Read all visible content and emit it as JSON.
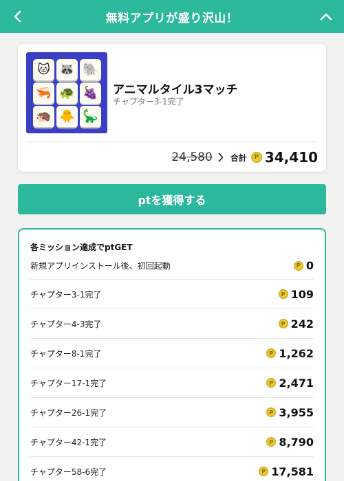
{
  "header": {
    "title": "無料アプリが盛り沢山！",
    "back_icon": "chevron-left-icon",
    "collapse_icon": "chevron-up-icon"
  },
  "app": {
    "name": "アニマルタイル3マッチ",
    "chapter": "チャプター3-1完了",
    "tiles": [
      "🐱",
      "🦝",
      "🐘",
      "🦐",
      "🐢",
      "🍇",
      "🦔",
      "🐥",
      "🦕"
    ],
    "old_points": "24,580",
    "total_label": "合計",
    "total_points": "34,410",
    "coin_symbol": "P"
  },
  "cta": {
    "label": "ptを獲得する"
  },
  "missions": {
    "header": "各ミッション達成でptGET",
    "items": [
      {
        "label": "新規アプリインストール後、初回起動",
        "points": "0"
      },
      {
        "label": "チャプター3-1完了",
        "points": "109"
      },
      {
        "label": "チャプター4-3完了",
        "points": "242"
      },
      {
        "label": "チャプター8-1完了",
        "points": "1,262"
      },
      {
        "label": "チャプター17-1完了",
        "points": "2,471"
      },
      {
        "label": "チャプター26-1完了",
        "points": "3,955"
      },
      {
        "label": "チャプター42-1完了",
        "points": "8,790"
      },
      {
        "label": "チャプター58-6完了",
        "points": "17,581"
      }
    ]
  },
  "colors": {
    "brand": "#2bb89b",
    "coin": "#e8c93a",
    "icon_bg": "#3a3fc4"
  }
}
